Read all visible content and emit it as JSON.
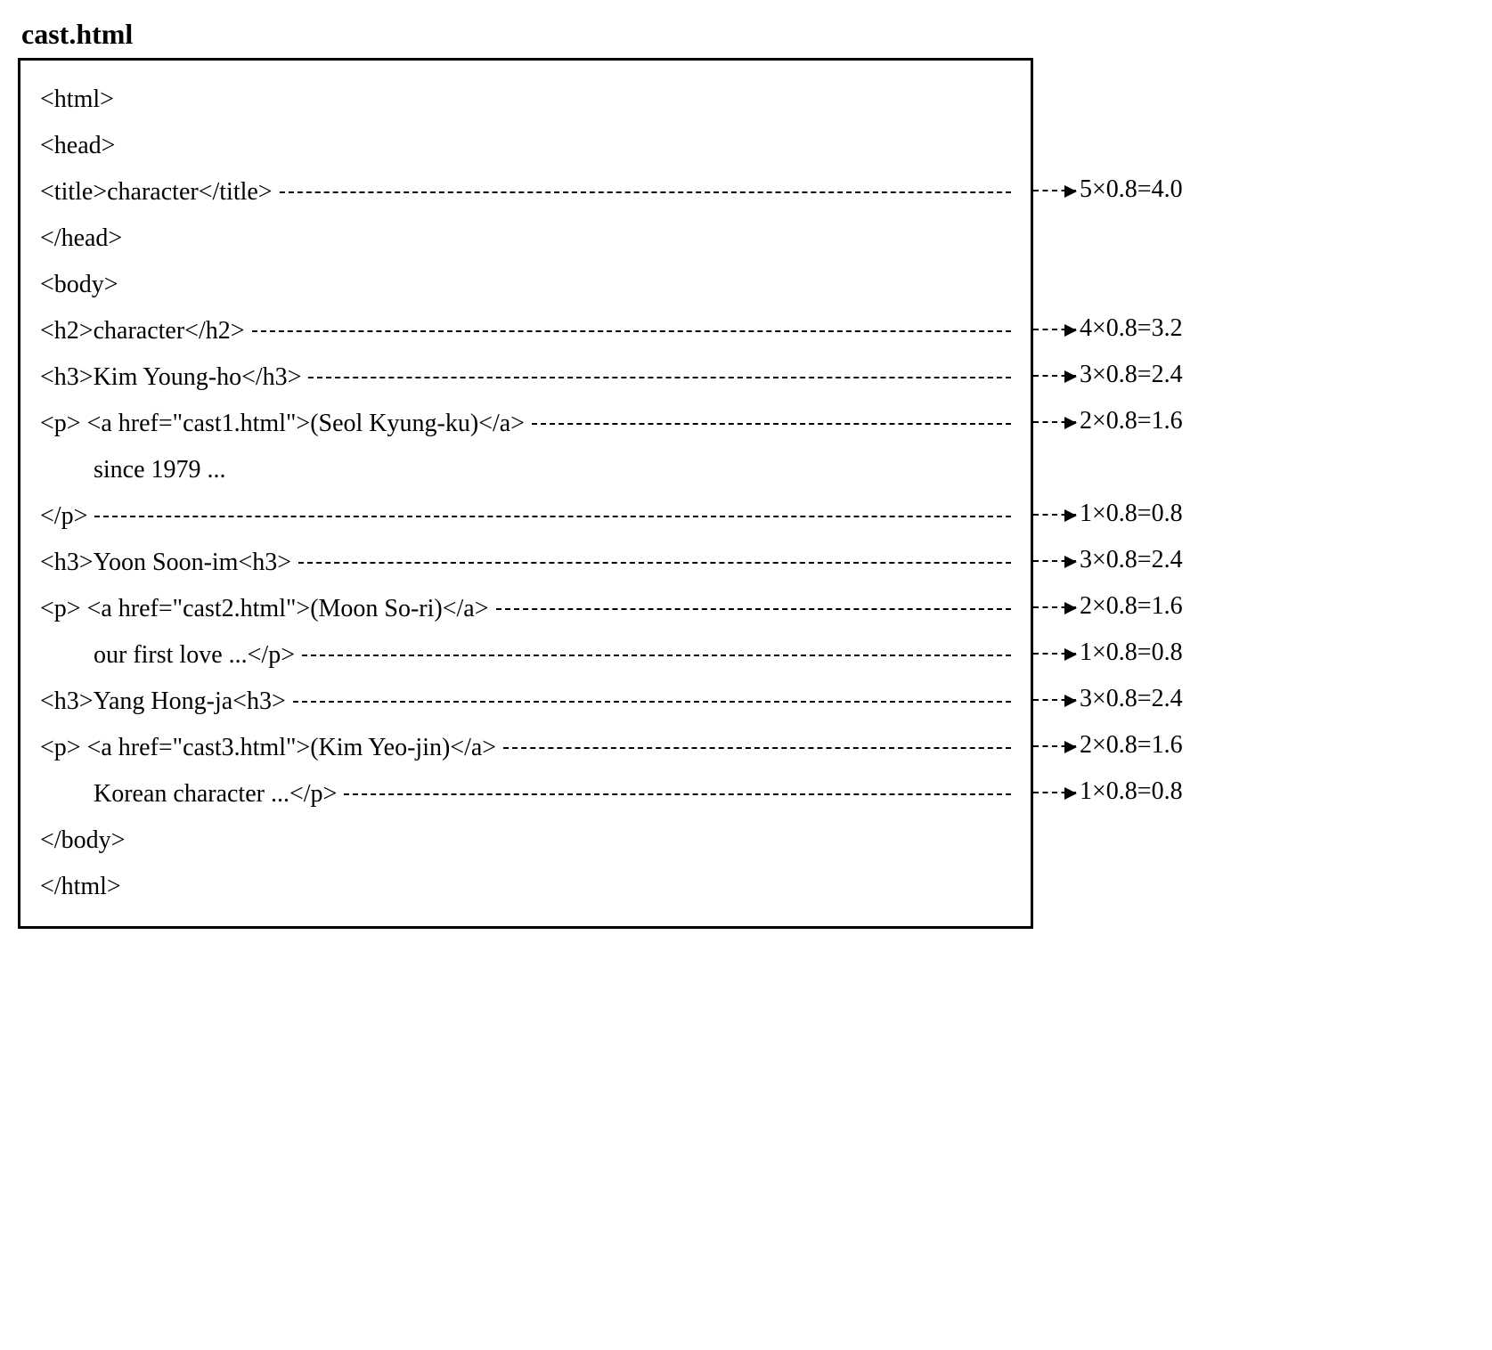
{
  "title": "cast.html",
  "code": {
    "l1": "<html>",
    "l2": "<head>",
    "l3": "<title>character</title>",
    "l4": "</head>",
    "l5": "<body>",
    "l6": "<h2>character</h2>",
    "l7": "<h3>Kim Young-ho</h3>",
    "l8": "<p> <a href=\"cast1.html\">(Seol Kyung-ku)</a>",
    "l9": "since 1979 ...",
    "l10": "</p>",
    "l11": "<h3>Yoon Soon-im<h3>",
    "l12": "<p> <a href=\"cast2.html\">(Moon So-ri)</a>",
    "l13": "our first love ...</p>",
    "l14": "<h3>Yang Hong-ja<h3>",
    "l15": "<p> <a href=\"cast3.html\">(Kim Yeo-jin)</a>",
    "l16": "Korean character ...</p>",
    "l17": "</body>",
    "l18": "</html>"
  },
  "ann": {
    "a3": "5×0.8=4.0",
    "a6": "4×0.8=3.2",
    "a7": "3×0.8=2.4",
    "a8": "2×0.8=1.6",
    "a10": "1×0.8=0.8",
    "a11": "3×0.8=2.4",
    "a12": "2×0.8=1.6",
    "a13": "1×0.8=0.8",
    "a14": "3×0.8=2.4",
    "a15": "2×0.8=1.6",
    "a16": "1×0.8=0.8"
  }
}
